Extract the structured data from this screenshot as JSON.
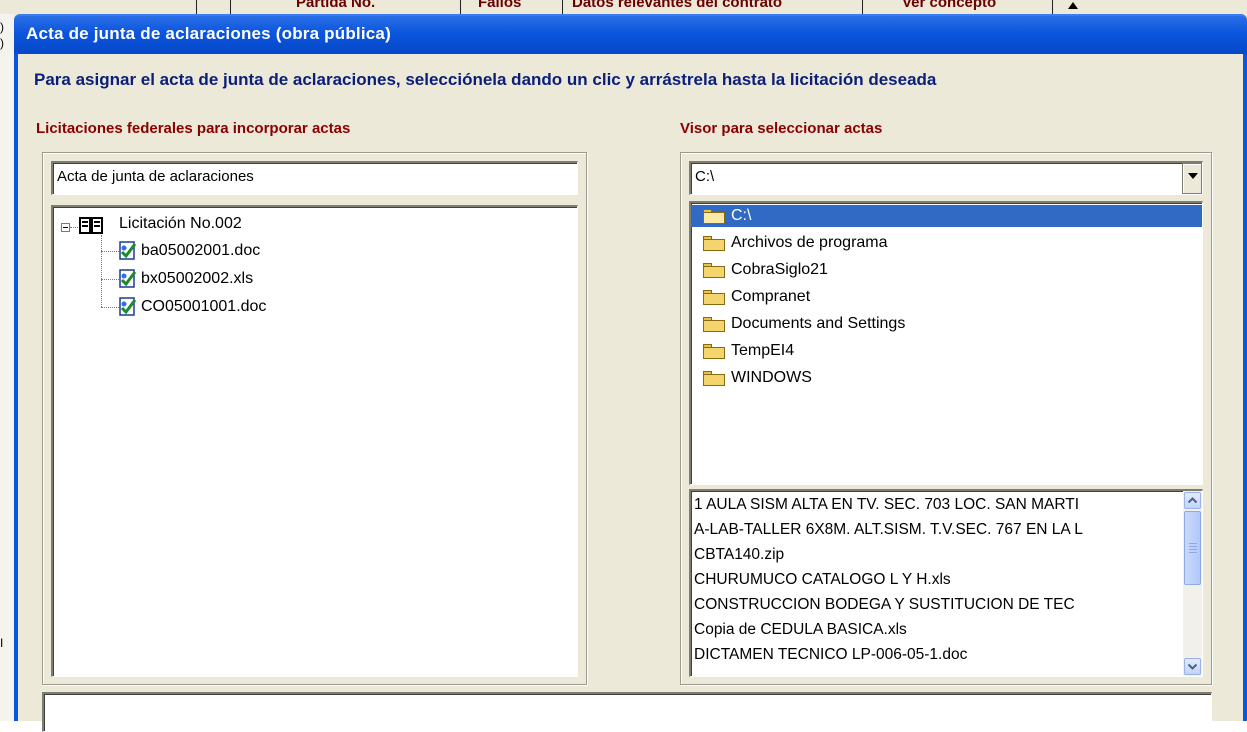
{
  "background_window": {
    "columns": [
      "Partida No.",
      "Fallos",
      "Datos relevantes del contrato",
      "Ver concepto"
    ]
  },
  "dialog": {
    "title": "Acta de junta de aclaraciones (obra pública)",
    "instruction": "Para asignar el acta de junta de aclaraciones, selecciónela dando un clic y arrástrela hasta la licitación deseada"
  },
  "left_panel": {
    "label": "Licitaciones federales  para incorporar actas",
    "textbox_value": "Acta de junta de aclaraciones",
    "tree": {
      "root": "Licitación No.002",
      "children": [
        "ba05002001.doc",
        "bx05002002.xls",
        "CO05001001.doc"
      ]
    }
  },
  "right_panel": {
    "label": "Visor para seleccionar actas",
    "drive_value": "C:\\",
    "directories": [
      "C:\\",
      "Archivos de programa",
      "CobraSiglo21",
      "Compranet",
      "Documents and Settings",
      "TempEI4",
      "WINDOWS"
    ],
    "files": [
      "1 AULA SISM ALTA EN TV. SEC. 703 LOC. SAN MARTI",
      "A-LAB-TALLER 6X8M. ALT.SISM. T.V.SEC. 767 EN LA L",
      "CBTA140.zip",
      "CHURUMUCO CATALOGO L Y H.xls",
      "CONSTRUCCION BODEGA Y SUSTITUCION DE TEC",
      "Copia de CEDULA BASICA.xls",
      "DICTAMEN TECNICO LP-006-05-1.doc"
    ]
  },
  "icons": {
    "tree_root": "book-icon",
    "tree_child": "document-check-icon",
    "directory": "folder-icon",
    "scroll_up": "arrow-up-icon",
    "scroll_down": "arrow-down-icon",
    "combo": "dropdown-arrow-icon"
  },
  "colors": {
    "titlebar": "#0b55dd",
    "selection": "#316ac5",
    "label": "#8b0000",
    "instruction": "#0b1e7a",
    "dialog_bg": "#ece9d8"
  }
}
